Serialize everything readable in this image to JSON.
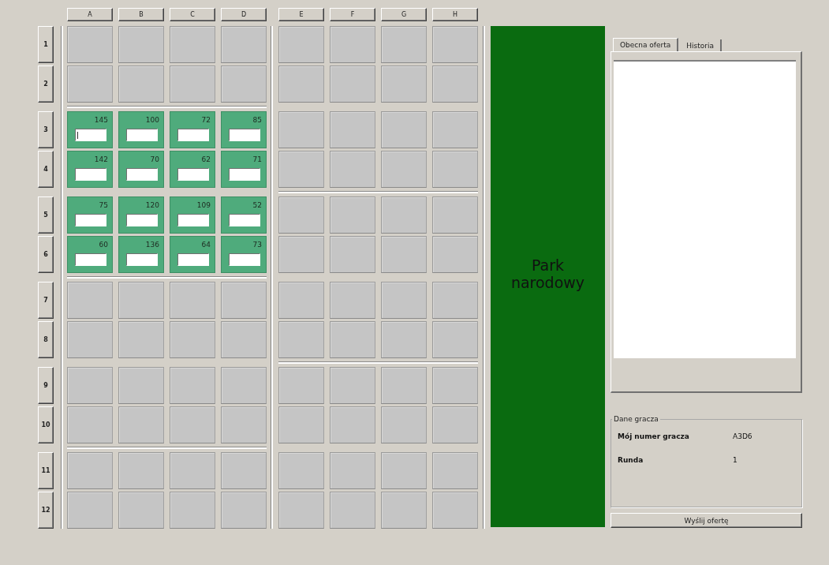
{
  "columns": [
    {
      "label": "A"
    },
    {
      "label": "B"
    },
    {
      "label": "C"
    },
    {
      "label": "D"
    },
    {
      "label": "E"
    },
    {
      "label": "F"
    },
    {
      "label": "G"
    },
    {
      "label": "H"
    }
  ],
  "rows": [
    {
      "label": "1",
      "cells": [
        {
          "kind": "empty"
        },
        {
          "kind": "empty"
        },
        {
          "kind": "empty"
        },
        {
          "kind": "empty"
        },
        {
          "kind": "empty"
        },
        {
          "kind": "empty"
        },
        {
          "kind": "empty"
        },
        {
          "kind": "empty"
        }
      ]
    },
    {
      "label": "2",
      "cells": [
        {
          "kind": "empty"
        },
        {
          "kind": "empty"
        },
        {
          "kind": "empty"
        },
        {
          "kind": "empty"
        },
        {
          "kind": "empty"
        },
        {
          "kind": "empty"
        },
        {
          "kind": "empty"
        },
        {
          "kind": "empty"
        }
      ]
    },
    {
      "label": "3",
      "cells": [
        {
          "kind": "offer",
          "value": "145",
          "focused": true
        },
        {
          "kind": "offer",
          "value": "100",
          "focused": false
        },
        {
          "kind": "offer",
          "value": "72",
          "focused": false
        },
        {
          "kind": "offer",
          "value": "85",
          "focused": false
        },
        {
          "kind": "empty"
        },
        {
          "kind": "empty"
        },
        {
          "kind": "empty"
        },
        {
          "kind": "empty"
        }
      ]
    },
    {
      "label": "4",
      "cells": [
        {
          "kind": "offer",
          "value": "142",
          "focused": false
        },
        {
          "kind": "offer",
          "value": "70",
          "focused": false
        },
        {
          "kind": "offer",
          "value": "62",
          "focused": false
        },
        {
          "kind": "offer",
          "value": "71",
          "focused": false
        },
        {
          "kind": "empty"
        },
        {
          "kind": "empty"
        },
        {
          "kind": "empty"
        },
        {
          "kind": "empty"
        }
      ]
    },
    {
      "label": "5",
      "cells": [
        {
          "kind": "offer",
          "value": "75",
          "focused": false
        },
        {
          "kind": "offer",
          "value": "120",
          "focused": false
        },
        {
          "kind": "offer",
          "value": "109",
          "focused": false
        },
        {
          "kind": "offer",
          "value": "52",
          "focused": false
        },
        {
          "kind": "empty"
        },
        {
          "kind": "empty"
        },
        {
          "kind": "empty"
        },
        {
          "kind": "empty"
        }
      ]
    },
    {
      "label": "6",
      "cells": [
        {
          "kind": "offer",
          "value": "60",
          "focused": false
        },
        {
          "kind": "offer",
          "value": "136",
          "focused": false
        },
        {
          "kind": "offer",
          "value": "64",
          "focused": false
        },
        {
          "kind": "offer",
          "value": "73",
          "focused": false
        },
        {
          "kind": "empty"
        },
        {
          "kind": "empty"
        },
        {
          "kind": "empty"
        },
        {
          "kind": "empty"
        }
      ]
    },
    {
      "label": "7",
      "cells": [
        {
          "kind": "empty"
        },
        {
          "kind": "empty"
        },
        {
          "kind": "empty"
        },
        {
          "kind": "empty"
        },
        {
          "kind": "empty"
        },
        {
          "kind": "empty"
        },
        {
          "kind": "empty"
        },
        {
          "kind": "empty"
        }
      ]
    },
    {
      "label": "8",
      "cells": [
        {
          "kind": "empty"
        },
        {
          "kind": "empty"
        },
        {
          "kind": "empty"
        },
        {
          "kind": "empty"
        },
        {
          "kind": "empty"
        },
        {
          "kind": "empty"
        },
        {
          "kind": "empty"
        },
        {
          "kind": "empty"
        }
      ]
    },
    {
      "label": "9",
      "cells": [
        {
          "kind": "empty"
        },
        {
          "kind": "empty"
        },
        {
          "kind": "empty"
        },
        {
          "kind": "empty"
        },
        {
          "kind": "empty"
        },
        {
          "kind": "empty"
        },
        {
          "kind": "empty"
        },
        {
          "kind": "empty"
        }
      ]
    },
    {
      "label": "10",
      "cells": [
        {
          "kind": "empty"
        },
        {
          "kind": "empty"
        },
        {
          "kind": "empty"
        },
        {
          "kind": "empty"
        },
        {
          "kind": "empty"
        },
        {
          "kind": "empty"
        },
        {
          "kind": "empty"
        },
        {
          "kind": "empty"
        }
      ]
    },
    {
      "label": "11",
      "cells": [
        {
          "kind": "empty"
        },
        {
          "kind": "empty"
        },
        {
          "kind": "empty"
        },
        {
          "kind": "empty"
        },
        {
          "kind": "empty"
        },
        {
          "kind": "empty"
        },
        {
          "kind": "empty"
        },
        {
          "kind": "empty"
        }
      ]
    },
    {
      "label": "12",
      "cells": [
        {
          "kind": "empty"
        },
        {
          "kind": "empty"
        },
        {
          "kind": "empty"
        },
        {
          "kind": "empty"
        },
        {
          "kind": "empty"
        },
        {
          "kind": "empty"
        },
        {
          "kind": "empty"
        },
        {
          "kind": "empty"
        }
      ]
    }
  ],
  "park": {
    "label": "Park narodowy"
  },
  "tabs": [
    {
      "label": "Obecna oferta",
      "selected": true
    },
    {
      "label": "Historia",
      "selected": false
    }
  ],
  "player_data": {
    "title": "Dane gracza",
    "fields": [
      {
        "label": "Mój numer gracza",
        "value": "A3D6"
      },
      {
        "label": "Runda",
        "value": "1"
      }
    ]
  },
  "send_button": "Wyślij ofertę"
}
